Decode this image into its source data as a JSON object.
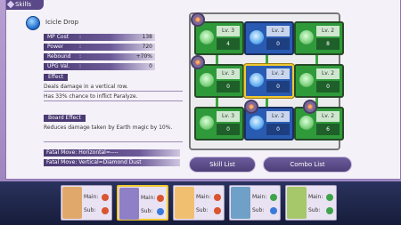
{
  "header": {
    "tab_label": "Skills"
  },
  "skill": {
    "name": "Icicle Drop"
  },
  "stats": [
    {
      "label": "MP Cost",
      "sep": ":",
      "value": "138"
    },
    {
      "label": "Power",
      "sep": ":",
      "value": "720"
    },
    {
      "label": "Rebound",
      "sep": ":",
      "value": "+70%"
    },
    {
      "label": "UPG Val.",
      "sep": ":",
      "value": "0"
    }
  ],
  "effect": {
    "title": "Effect",
    "lines": [
      "Deals damage in a vertical row.",
      "Has 33% chance to inflict Paralyze."
    ]
  },
  "board_effect": {
    "title": "Board Effect",
    "text": "Reduces damage taken by Earth magic by 10%."
  },
  "fatal_moves": [
    "Fatal Move: Horizontal=----",
    "Fatal Move: Vertical=Diamond Dust"
  ],
  "grid": {
    "nodes": [
      {
        "element": "earth",
        "color": "green",
        "level": "Lv. 3",
        "value": "4",
        "selected": false
      },
      {
        "element": "water",
        "color": "blue",
        "level": "Lv. 2",
        "value": "0",
        "selected": false
      },
      {
        "element": "earth",
        "color": "green",
        "level": "Lv. 2",
        "value": "8",
        "selected": false
      },
      {
        "element": "earth",
        "color": "green",
        "level": "Lv. 3",
        "value": "0",
        "selected": false
      },
      {
        "element": "water",
        "color": "blue",
        "level": "Lv. 2",
        "value": "0",
        "selected": true
      },
      {
        "element": "earth",
        "color": "green",
        "level": "Lv. 2",
        "value": "0",
        "selected": false
      },
      {
        "element": "earth",
        "color": "green",
        "level": "Lv. 3",
        "value": "0",
        "selected": false
      },
      {
        "element": "water",
        "color": "blue",
        "level": "Lv. 2",
        "value": "0",
        "selected": false
      },
      {
        "element": "earth",
        "color": "green",
        "level": "Lv. 2",
        "value": "6",
        "selected": false
      }
    ]
  },
  "buttons": {
    "skill_list": "Skill List",
    "combo_list": "Combo List"
  },
  "party": {
    "main_label": "Main:",
    "sub_label": "Sub:",
    "members": [
      {
        "portrait_color": "#e0a86a",
        "main_elem": "#d9542f",
        "sub_elem": "#d9542f",
        "active": false
      },
      {
        "portrait_color": "#8e7fc7",
        "main_elem": "#d9542f",
        "sub_elem": "#3a7ad9",
        "active": true
      },
      {
        "portrait_color": "#f0c070",
        "main_elem": "#d9542f",
        "sub_elem": "#d9542f",
        "active": false
      },
      {
        "portrait_color": "#6fa0c8",
        "main_elem": "#3fa34a",
        "sub_elem": "#3a7ad9",
        "active": false
      },
      {
        "portrait_color": "#a6c86a",
        "main_elem": "#3fa34a",
        "sub_elem": "#3fa34a",
        "active": false
      }
    ]
  }
}
